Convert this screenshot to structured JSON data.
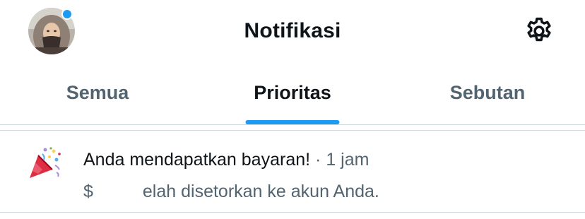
{
  "header": {
    "title": "Notifikasi",
    "avatar_icon": "user-avatar",
    "settings_icon": "gear-icon",
    "unread_dot_color": "#1d9bf0"
  },
  "tabs": [
    {
      "label": "Semua",
      "active": false
    },
    {
      "label": "Prioritas",
      "active": true
    },
    {
      "label": "Sebutan",
      "active": false
    }
  ],
  "notification": {
    "icon": "party-popper-icon",
    "heading": "Anda mendapatkan bayaran!",
    "separator": "·",
    "time": "1 jam",
    "body_prefix": "$",
    "body_suffix": "elah disetorkan ke akun Anda."
  },
  "colors": {
    "accent": "#1d9bf0",
    "text_primary": "#0f1419",
    "text_secondary": "#536471",
    "border": "#cfd9de"
  }
}
